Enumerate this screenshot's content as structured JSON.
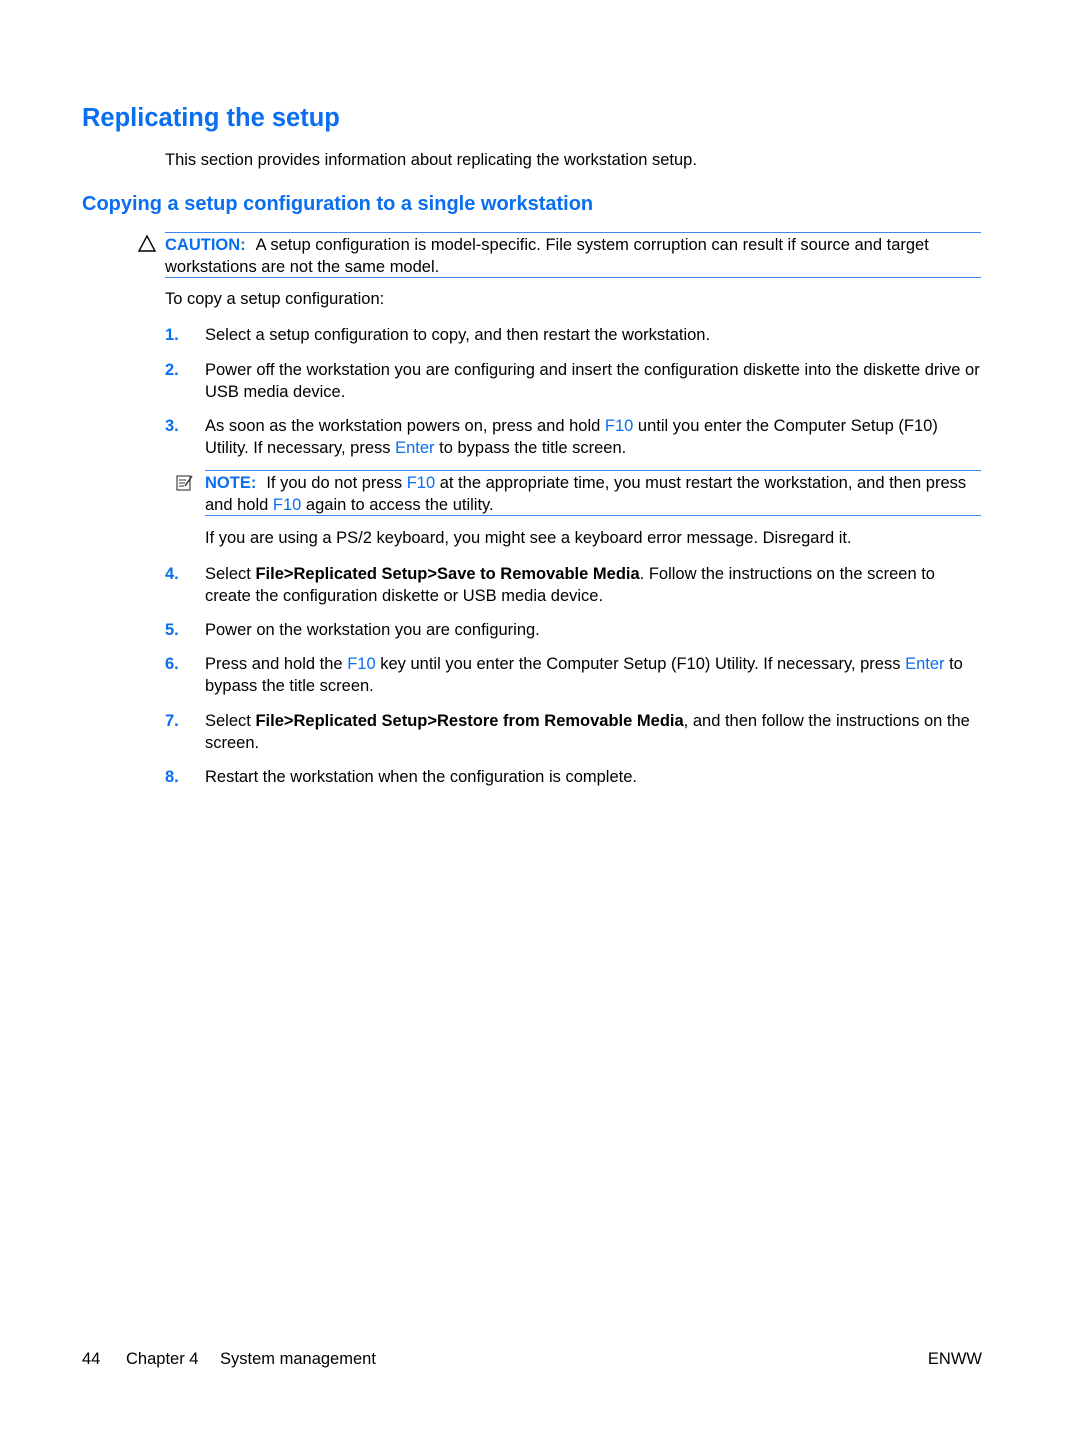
{
  "heading": "Replicating the setup",
  "intro": "This section provides information about replicating the workstation setup.",
  "subheading": "Copying a setup configuration to a single workstation",
  "caution": {
    "icon": "caution-triangle-icon",
    "label": "CAUTION:",
    "text": "A setup configuration is model-specific. File system corruption can result if source and target workstations are not the same model."
  },
  "lead": "To copy a setup configuration:",
  "steps": [
    {
      "num": "1.",
      "parts": [
        {
          "t": "Select a setup configuration to copy, and then restart the workstation."
        }
      ]
    },
    {
      "num": "2.",
      "parts": [
        {
          "t": "Power off the workstation you are configuring and insert the configuration diskette into the diskette drive or USB media device."
        }
      ]
    },
    {
      "num": "3.",
      "parts": [
        {
          "t": "As soon as the workstation powers on, press and hold "
        },
        {
          "t": "F10",
          "s": "blue"
        },
        {
          "t": " until you enter the Computer Setup (F10) Utility. If necessary, press "
        },
        {
          "t": "Enter",
          "s": "blue"
        },
        {
          "t": " to bypass the title screen."
        }
      ]
    },
    {
      "num": "4.",
      "parts": [
        {
          "t": "Select "
        },
        {
          "t": "File>Replicated Setup>Save to Removable Media",
          "s": "bold"
        },
        {
          "t": ". Follow the instructions on the screen to create the configuration diskette or USB media device."
        }
      ]
    },
    {
      "num": "5.",
      "parts": [
        {
          "t": "Power on the workstation you are configuring."
        }
      ]
    },
    {
      "num": "6.",
      "parts": [
        {
          "t": "Press and hold the "
        },
        {
          "t": "F10",
          "s": "blue"
        },
        {
          "t": " key until you enter the Computer Setup (F10) Utility. If necessary, press "
        },
        {
          "t": "Enter",
          "s": "blue"
        },
        {
          "t": " to bypass the title screen."
        }
      ]
    },
    {
      "num": "7.",
      "parts": [
        {
          "t": "Select "
        },
        {
          "t": "File>Replicated Setup>Restore from Removable Media",
          "s": "bold"
        },
        {
          "t": ", and then follow the instructions on the screen."
        }
      ]
    },
    {
      "num": "8.",
      "parts": [
        {
          "t": "Restart the workstation when the configuration is complete."
        }
      ]
    }
  ],
  "note": {
    "icon": "note-pad-icon",
    "label": "NOTE:",
    "parts": [
      {
        "t": "If you do not press "
      },
      {
        "t": "F10",
        "s": "blue"
      },
      {
        "t": " at the appropriate time, you must restart the workstation, and then press and hold "
      },
      {
        "t": "F10",
        "s": "blue"
      },
      {
        "t": " again to access the utility."
      }
    ]
  },
  "note_followup": "If you are using a PS/2 keyboard, you might see a keyboard error message. Disregard it.",
  "footer": {
    "page_number": "44",
    "chapter": "Chapter 4",
    "section": "System management",
    "code": "ENWW"
  }
}
